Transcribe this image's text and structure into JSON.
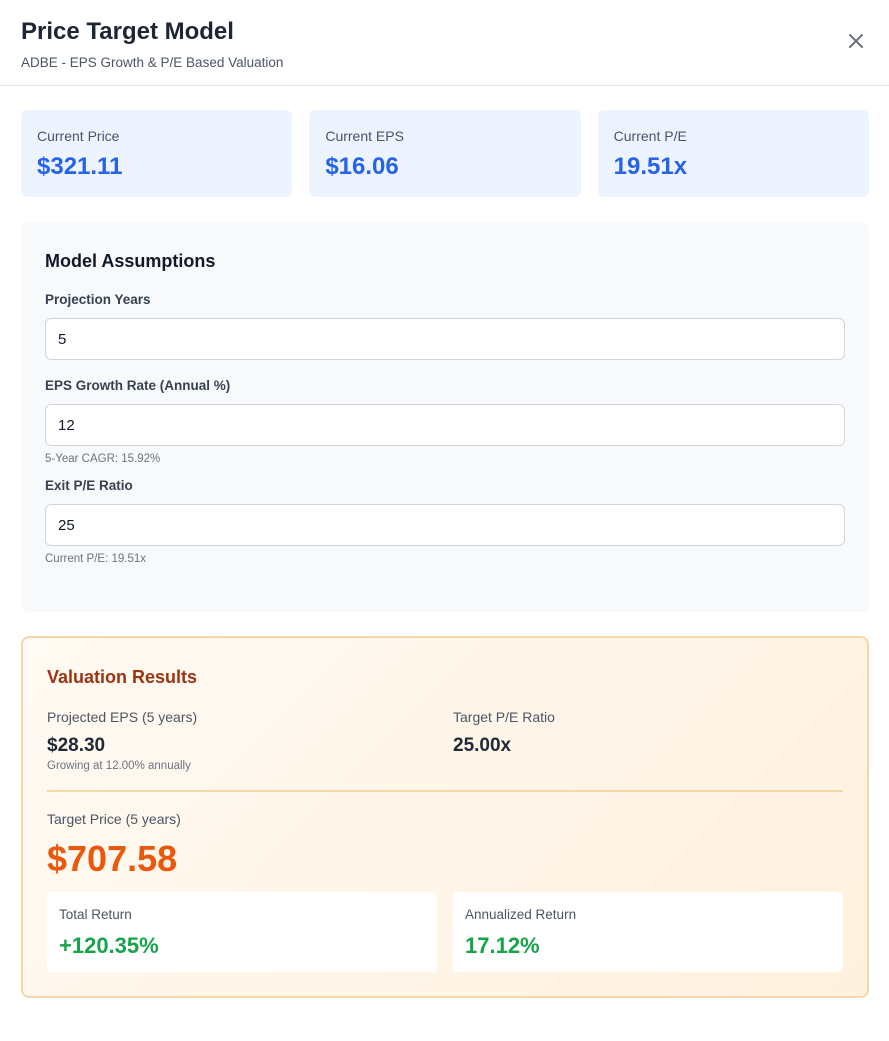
{
  "header": {
    "title": "Price Target Model",
    "subtitle": "ADBE - EPS Growth & P/E Based Valuation",
    "close_icon": "close-icon"
  },
  "stats": [
    {
      "label": "Current Price",
      "value": "$321.11"
    },
    {
      "label": "Current EPS",
      "value": "$16.06"
    },
    {
      "label": "Current P/E",
      "value": "19.51x"
    }
  ],
  "assumptions": {
    "title": "Model Assumptions",
    "projection_years": {
      "label": "Projection Years",
      "value": "5"
    },
    "eps_growth": {
      "label": "EPS Growth Rate (Annual %)",
      "value": "12",
      "hint": "5-Year CAGR: 15.92%"
    },
    "exit_pe": {
      "label": "Exit P/E Ratio",
      "value": "25",
      "hint": "Current P/E: 19.51x"
    }
  },
  "results": {
    "title": "Valuation Results",
    "projected_eps": {
      "label": "Projected EPS (5 years)",
      "value": "$28.30",
      "hint": "Growing at 12.00% annually"
    },
    "target_pe": {
      "label": "Target P/E Ratio",
      "value": "25.00x"
    },
    "target_price": {
      "label": "Target Price (5 years)",
      "value": "$707.58"
    },
    "total_return": {
      "label": "Total Return",
      "value": "+120.35%"
    },
    "annualized_return": {
      "label": "Annualized Return",
      "value": "17.12%"
    }
  },
  "colors": {
    "accent_blue": "#2563eb",
    "accent_orange": "#ea580c",
    "positive_green": "#16a34a",
    "results_title": "#9a3412"
  }
}
